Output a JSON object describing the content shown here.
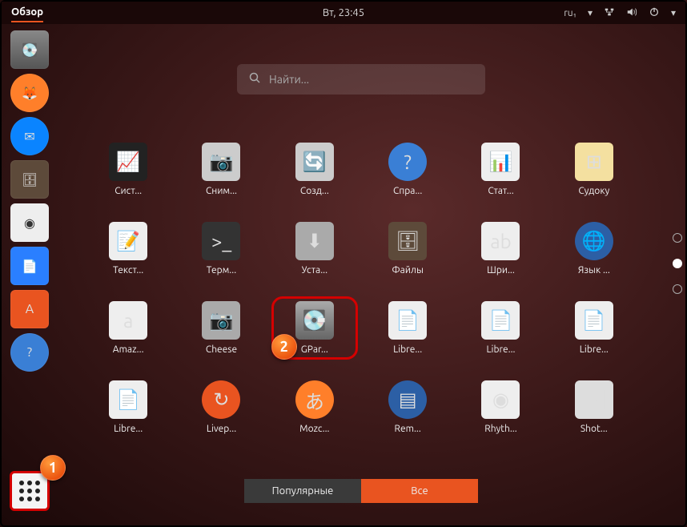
{
  "topbar": {
    "overview_label": "Обзор",
    "clock": "Вт, 23:45",
    "keyboard_layout": "ru₁"
  },
  "search": {
    "placeholder": "Найти..."
  },
  "tabs": {
    "popular": "Популярные",
    "all": "Все"
  },
  "launcher": [
    {
      "name": "disks",
      "glyph": "💽"
    },
    {
      "name": "firefox",
      "glyph": "🦊"
    },
    {
      "name": "thunderbird",
      "glyph": "✉"
    },
    {
      "name": "files",
      "glyph": "🗄"
    },
    {
      "name": "rhythmbox",
      "glyph": "◉"
    },
    {
      "name": "writer",
      "glyph": "📄"
    },
    {
      "name": "software",
      "glyph": "A"
    },
    {
      "name": "help",
      "glyph": "?"
    }
  ],
  "apps": [
    {
      "label": "Сист...",
      "icon": "ic-monitor",
      "glyph": "📈"
    },
    {
      "label": "Сним...",
      "icon": "ic-shot",
      "glyph": "📷"
    },
    {
      "label": "Созд...",
      "icon": "ic-update",
      "glyph": "🔄"
    },
    {
      "label": "Спра...",
      "icon": "ic-help2",
      "glyph": "?"
    },
    {
      "label": "Стат...",
      "icon": "ic-calc",
      "glyph": "📊"
    },
    {
      "label": "Судоку",
      "icon": "ic-sudoku",
      "glyph": "⊞"
    },
    {
      "label": "Текст...",
      "icon": "ic-text",
      "glyph": "📝"
    },
    {
      "label": "Терм...",
      "icon": "ic-term",
      "glyph": ">_"
    },
    {
      "label": "Уста...",
      "icon": "ic-install",
      "glyph": "⬇"
    },
    {
      "label": "Файлы",
      "icon": "ic-files2",
      "glyph": "🗄"
    },
    {
      "label": "Шри...",
      "icon": "ic-font",
      "glyph": "ab"
    },
    {
      "label": "Язык ...",
      "icon": "ic-lang",
      "glyph": "🌐"
    },
    {
      "label": "Amaz...",
      "icon": "ic-amz",
      "glyph": "a"
    },
    {
      "label": "Cheese",
      "icon": "ic-cheese",
      "glyph": "📷"
    },
    {
      "label": "GPar...",
      "icon": "ic-gpart",
      "glyph": "💽",
      "highlight": true
    },
    {
      "label": "Libre...",
      "icon": "ic-lo1",
      "glyph": "📄"
    },
    {
      "label": "Libre...",
      "icon": "ic-lo2",
      "glyph": "📄"
    },
    {
      "label": "Libre...",
      "icon": "ic-lo3",
      "glyph": "📄"
    },
    {
      "label": "Libre...",
      "icon": "ic-lo4",
      "glyph": "📄"
    },
    {
      "label": "Livep...",
      "icon": "ic-live",
      "glyph": "↻"
    },
    {
      "label": "Mozc...",
      "icon": "ic-mozc",
      "glyph": "あ"
    },
    {
      "label": "Rem...",
      "icon": "ic-rem",
      "glyph": "▤"
    },
    {
      "label": "Rhyth...",
      "icon": "ic-rhy",
      "glyph": "◉"
    },
    {
      "label": "Shot...",
      "icon": "ic-shotw",
      "glyph": "🖼"
    }
  ],
  "callouts": {
    "1": "1",
    "2": "2"
  },
  "pager": {
    "pages": 3,
    "active": 1
  }
}
